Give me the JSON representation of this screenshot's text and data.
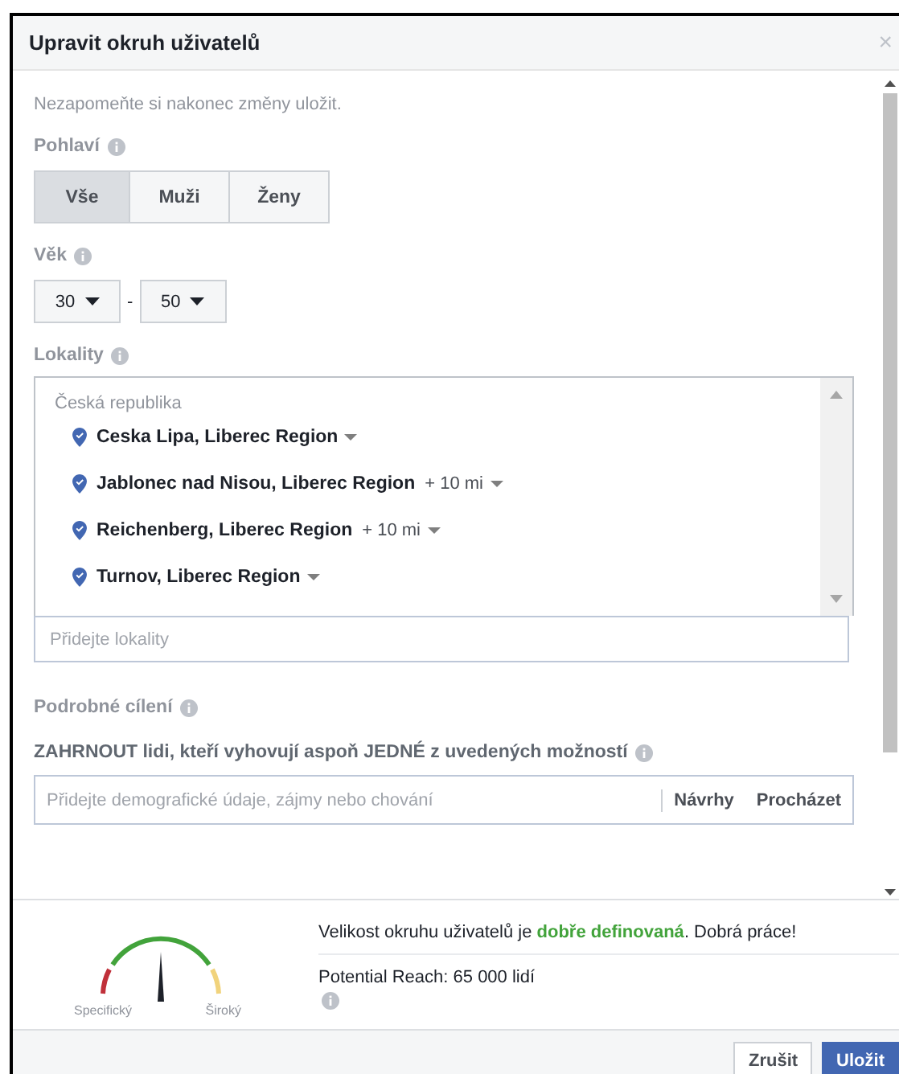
{
  "window": {
    "title": "Upravit okruh uživatelů",
    "close": "×"
  },
  "reminder": "Nezapomeňte si nakonec změny uložit.",
  "gender": {
    "label": "Pohlaví",
    "options": [
      {
        "label": "Vše",
        "selected": true
      },
      {
        "label": "Muži",
        "selected": false
      },
      {
        "label": "Ženy",
        "selected": false
      }
    ]
  },
  "age": {
    "label": "Věk",
    "from": "30",
    "separator": "-",
    "to": "50"
  },
  "locations": {
    "label": "Lokality",
    "country": "Česká republika",
    "items": [
      {
        "name": "Ceska Lipa, Liberec Region"
      },
      {
        "name": "Jablonec nad Nisou, Liberec Region",
        "radius": "+ 10 mi"
      },
      {
        "name": "Reichenberg, Liberec Region",
        "radius": "+ 10 mi"
      },
      {
        "name": "Turnov, Liberec Region"
      }
    ],
    "placeholder": "Přidejte lokality"
  },
  "detailed_targeting": {
    "label": "Podrobné cílení",
    "include": "ZAHRNOUT lidi, kteří vyhovují aspoň JEDNÉ z uvedených možností",
    "placeholder": "Přidejte demografické údaje, zájmy nebo chování",
    "suggestions": "Návrhy",
    "browse": "Procházet"
  },
  "audience": {
    "gauge_left": "Specifický",
    "gauge_right": "Široký",
    "definition": "Velikost okruhu uživatelů je **dobře definovaná**. Dobrá práce!",
    "reach": "Potential Reach: 65 000 lidí"
  },
  "buttons": [
    {
      "label": "Zrušit",
      "kind": "secondary"
    },
    {
      "label": "Uložit",
      "kind": "primary"
    }
  ]
}
